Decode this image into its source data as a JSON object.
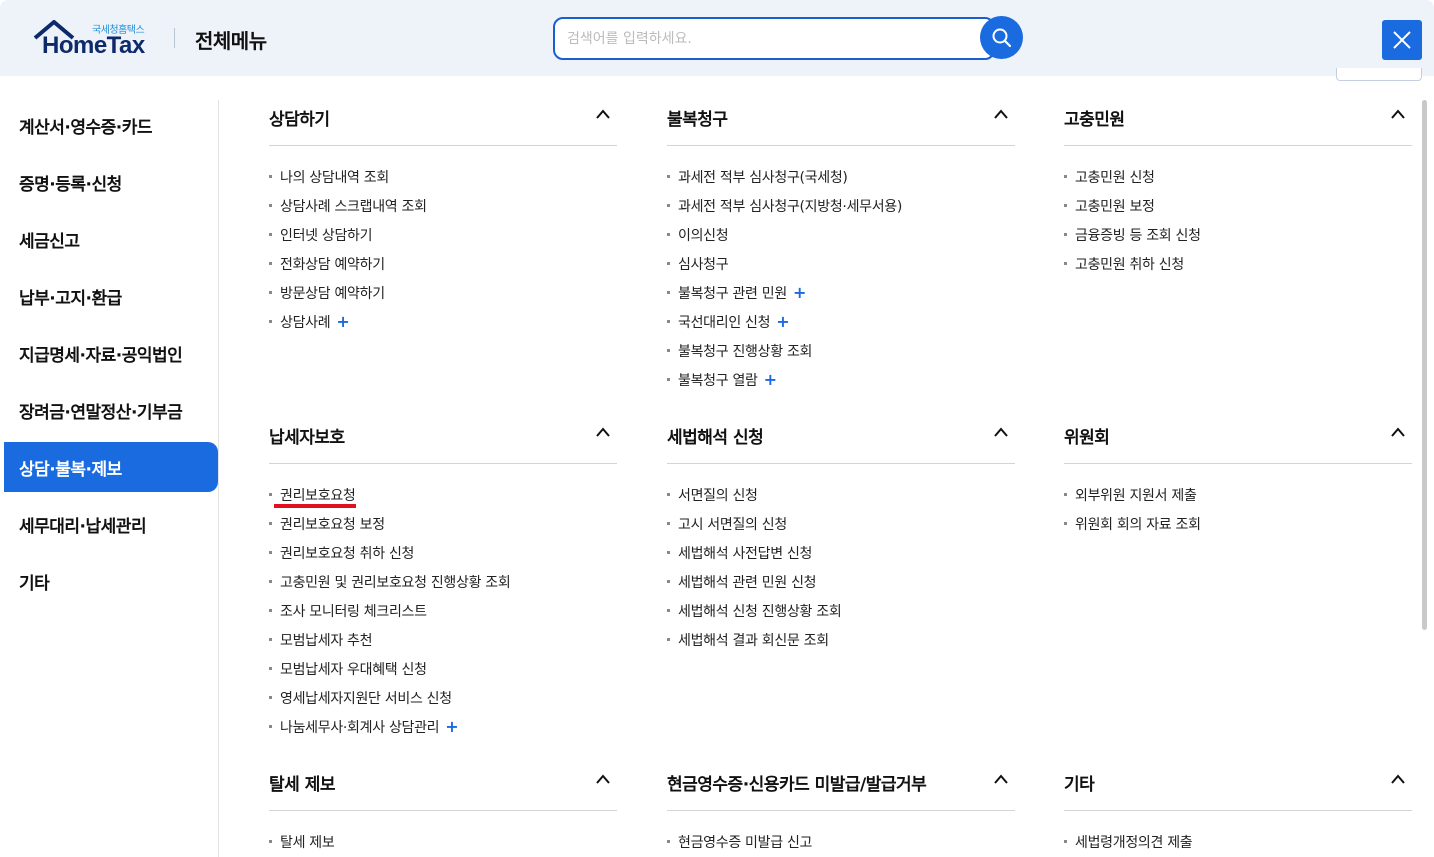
{
  "header": {
    "logo_sub": "국세청홈택스",
    "logo_main": "HomeTax",
    "title": "전체메뉴",
    "search_placeholder": "검색어를 입력하세요."
  },
  "colors": {
    "accent": "#1a6be0",
    "logo_navy": "#0d2a6b",
    "header_bg": "#eef3fa",
    "highlight_underline": "#e0101e"
  },
  "left_nav": {
    "items": [
      {
        "label": "계산서·영수증·카드"
      },
      {
        "label": "증명·등록·신청"
      },
      {
        "label": "세금신고"
      },
      {
        "label": "납부·고지·환급"
      },
      {
        "label": "지급명세·자료·공익법인"
      },
      {
        "label": "장려금·연말정산·기부금"
      },
      {
        "label": "상담·불복·제보",
        "active": true
      },
      {
        "label": "세무대리·납세관리"
      },
      {
        "label": "기타"
      }
    ]
  },
  "sections": {
    "consult": {
      "title": "상담하기",
      "items": [
        "나의 상담내역 조회",
        "상담사례 스크랩내역 조회",
        "인터넷 상담하기",
        "전화상담 예약하기",
        "방문상담 예약하기",
        "상담사례"
      ]
    },
    "appeal": {
      "title": "불복청구",
      "items": [
        "과세전 적부 심사청구(국세청)",
        "과세전 적부 심사청구(지방청·세무서용)",
        "이의신청",
        "심사청구",
        "불복청구 관련 민원",
        "국선대리인 신청",
        "불복청구 진행상황 조회",
        "불복청구 열람"
      ]
    },
    "grievance": {
      "title": "고충민원",
      "items": [
        "고충민원 신청",
        "고충민원 보정",
        "금융증빙 등 조회 신청",
        "고충민원 취하 신청"
      ]
    },
    "taxpayer_protection": {
      "title": "납세자보호",
      "items": [
        "권리보호요청",
        "권리보호요청 보정",
        "권리보호요청 취하 신청",
        "고충민원 및 권리보호요청 진행상황 조회",
        "조사 모니터링 체크리스트",
        "모범납세자 추천",
        "모범납세자 우대혜택 신청",
        "영세납세자지원단 서비스 신청",
        "나눔세무사·회계사 상담관리"
      ]
    },
    "tax_law": {
      "title": "세법해석 신청",
      "items": [
        "서면질의 신청",
        "고시 서면질의 신청",
        "세법해석 사전답변 신청",
        "세법해석 관련 민원 신청",
        "세법해석 신청 진행상황 조회",
        "세법해석 결과 회신문 조회"
      ]
    },
    "committee": {
      "title": "위원회",
      "items": [
        "외부위원 지원서 제출",
        "위원회 회의 자료 조회"
      ]
    },
    "tax_evasion": {
      "title": "탈세 제보",
      "items": [
        "탈세 제보"
      ]
    },
    "receipt": {
      "title": "현금영수증·신용카드 미발급/발급거부",
      "items": [
        "현금영수증 미발급 신고"
      ]
    },
    "other": {
      "title": "기타",
      "items": [
        "세법령개정의견 제출"
      ]
    }
  }
}
